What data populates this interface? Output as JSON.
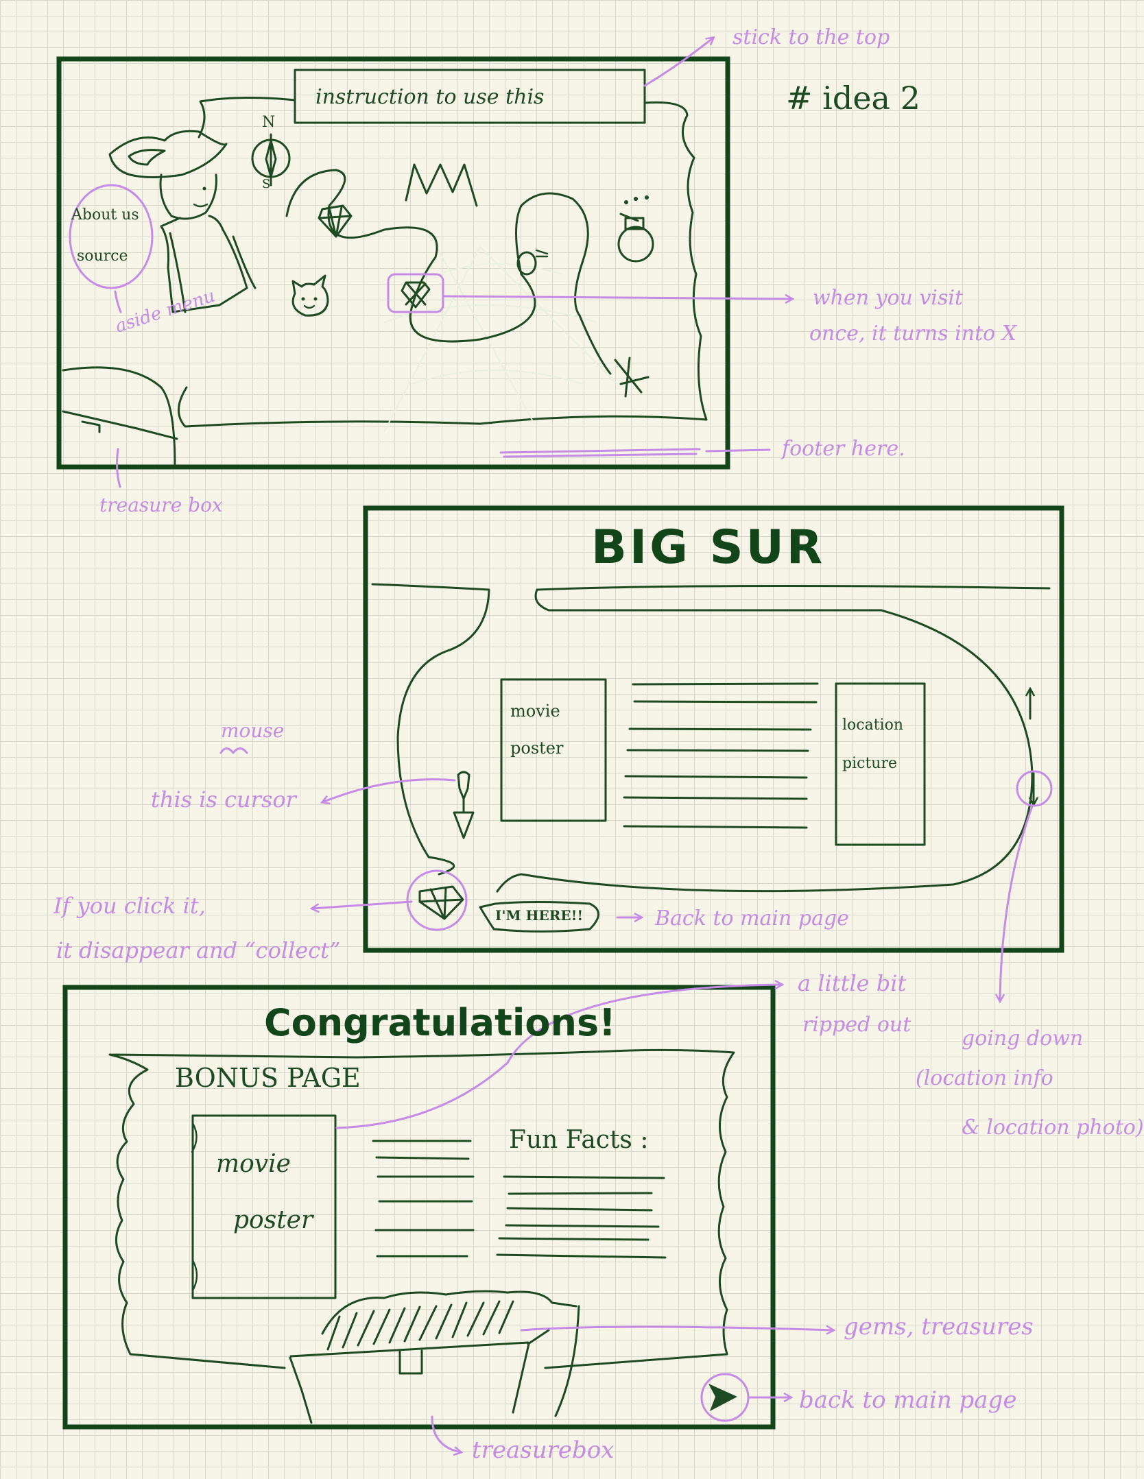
{
  "idea_label": "# idea 2",
  "panel1": {
    "banner": "instruction to use this",
    "compass_letter_n": "N",
    "compass_letter_s": "S",
    "aside_about": "About us",
    "aside_source": "source",
    "ann_aside": "aside menu",
    "ann_sticky": "stick to the top",
    "ann_visit_line1": "when you visit",
    "ann_visit_line2": "once, it turns into X",
    "ann_footer": "footer here.",
    "ann_treasure": "treasure box"
  },
  "panel2": {
    "title": "BIG SUR",
    "poster": "movie poster",
    "location": "location picture",
    "im_here": "I'M HERE!!",
    "ann_mouse": "mouse",
    "ann_cursor": "this is cursor",
    "ann_click_line1": "If you click it,",
    "ann_click_line2": "it disappear and “collect”",
    "ann_back": "Back to main page",
    "ann_down_line1": "going down",
    "ann_down_line2": "(location info",
    "ann_down_line3": "& location photo)"
  },
  "panel3": {
    "title": "Congratulations!",
    "bonus": "BONUS PAGE",
    "poster_line1": "movie",
    "poster_line2": "poster",
    "fun_facts": "Fun Facts :",
    "ann_ripped_line1": "a little bit",
    "ann_ripped_line2": "ripped out",
    "ann_gems": "gems, treasures",
    "ann_back": "back to main page",
    "ann_treasurebox": "treasurebox"
  },
  "colors": {
    "ink": "#1d4a22",
    "annotation": "#c68be4",
    "paper": "#f7f4e8"
  }
}
